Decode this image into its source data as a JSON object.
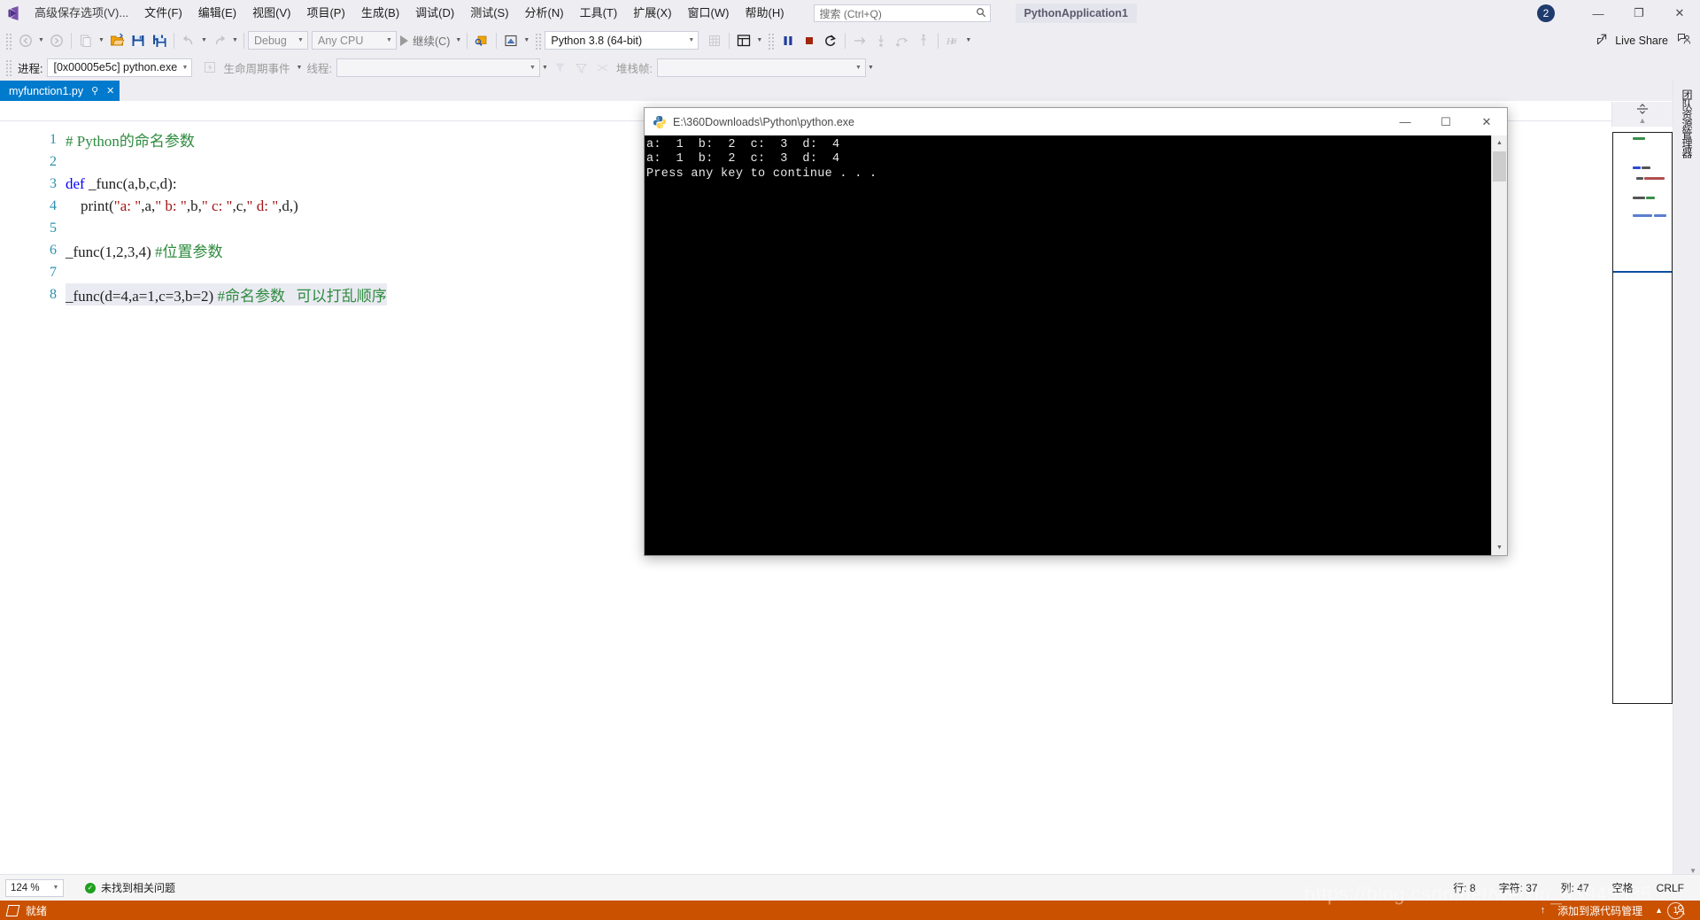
{
  "window": {
    "app_name": "Visual Studio",
    "project_name": "PythonApplication1",
    "notification_count": "2",
    "minimize": "—",
    "maximize": "❐",
    "close": "✕"
  },
  "menu": {
    "advanced_save": "高级保存选项(V)...",
    "items": [
      {
        "label": "文件(F)"
      },
      {
        "label": "编辑(E)"
      },
      {
        "label": "视图(V)"
      },
      {
        "label": "项目(P)"
      },
      {
        "label": "生成(B)"
      },
      {
        "label": "调试(D)"
      },
      {
        "label": "测试(S)"
      },
      {
        "label": "分析(N)"
      },
      {
        "label": "工具(T)"
      },
      {
        "label": "扩展(X)"
      },
      {
        "label": "窗口(W)"
      },
      {
        "label": "帮助(H)"
      }
    ]
  },
  "search": {
    "placeholder": "搜索 (Ctrl+Q)",
    "icon": "search-icon"
  },
  "live_share": {
    "label": "Live Share"
  },
  "toolbar": {
    "configuration": "Debug",
    "platform": "Any CPU",
    "continue_label": "继续(C)",
    "interpreter": "Python 3.8 (64-bit)"
  },
  "debug_toolbar": {
    "process_label": "进程:",
    "process_value": "[0x00005e5c] python.exe",
    "lifecycle_label": "生命周期事件",
    "thread_label": "线程:",
    "thread_value": "",
    "stackframe_label": "堆栈帧:",
    "stackframe_value": ""
  },
  "document_tab": {
    "filename": "myfunction1.py",
    "pin": "⚲",
    "close": "✕"
  },
  "right_dock": {
    "team_explorer": "团队资源管理器"
  },
  "editor": {
    "lines": [
      {
        "num": "1",
        "tokens": [
          {
            "t": "# Python的命名参数",
            "c": "k-comment"
          }
        ]
      },
      {
        "num": "2",
        "tokens": []
      },
      {
        "num": "3",
        "tokens": [
          {
            "t": "def ",
            "c": "k-keyword"
          },
          {
            "t": "_func(a,b,c,d):",
            "c": "k-fn"
          }
        ]
      },
      {
        "num": "4",
        "tokens": [
          {
            "t": "    print(",
            "c": "k-fn"
          },
          {
            "t": "\"a: \"",
            "c": "k-string"
          },
          {
            "t": ",a,",
            "c": "k-fn"
          },
          {
            "t": "\" b: \"",
            "c": "k-string"
          },
          {
            "t": ",b,",
            "c": "k-fn"
          },
          {
            "t": "\" c: \"",
            "c": "k-string"
          },
          {
            "t": ",c,",
            "c": "k-fn"
          },
          {
            "t": "\" d: \"",
            "c": "k-string"
          },
          {
            "t": ",d,)",
            "c": "k-fn"
          }
        ]
      },
      {
        "num": "5",
        "tokens": []
      },
      {
        "num": "6",
        "tokens": [
          {
            "t": "_func(1,2,3,4) ",
            "c": "k-fn"
          },
          {
            "t": "#位置参数",
            "c": "k-comment"
          }
        ]
      },
      {
        "num": "7",
        "tokens": []
      },
      {
        "num": "8",
        "highlight": true,
        "tokens": [
          {
            "t": "_func(d=4,a=1,c=3,b=2) ",
            "c": "k-fn"
          },
          {
            "t": "#命名参数   可以打乱顺序",
            "c": "k-comment"
          }
        ]
      }
    ]
  },
  "console": {
    "title": "E:\\360Downloads\\Python\\python.exe",
    "minimize": "—",
    "maximize": "☐",
    "close": "✕",
    "output": "a:  1  b:  2  c:  3  d:  4\na:  1  b:  2  c:  3  d:  4\nPress any key to continue . . ."
  },
  "zoom_bar": {
    "zoom_level": "124 %",
    "issue_status": "未找到相关问题",
    "issue_icon": "check-circle-icon",
    "line_label": "行: 8",
    "char_label": "字符: 37",
    "col_label": "列: 47",
    "space_label": "空格",
    "eol_label": "CRLF"
  },
  "statusbar": {
    "ready": "就绪",
    "source_control": "添加到源代码管理",
    "up_arrow": "↑",
    "caret": "▲",
    "watermark": "https://blog.csdn.net/weixin_43949535",
    "watermark_badge": "1"
  }
}
